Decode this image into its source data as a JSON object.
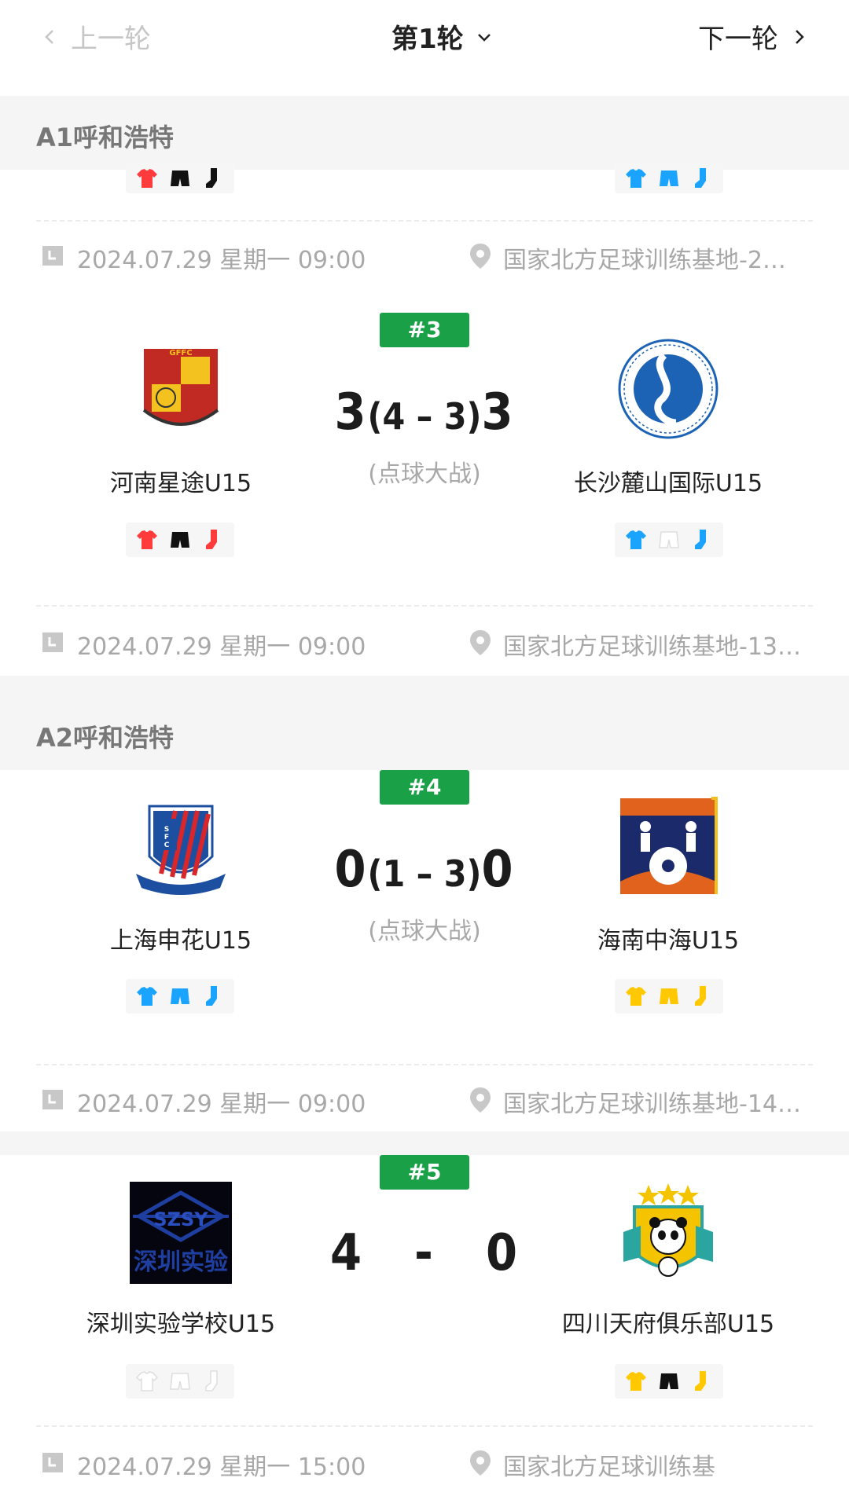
{
  "nav": {
    "prev": "上一轮",
    "round": "第1轮",
    "next": "下一轮"
  },
  "groups": [
    {
      "name": "A1呼和浩特"
    },
    {
      "name": "A2呼和浩特"
    }
  ],
  "top_partial": {
    "home_kit": [
      "#ff3b3b",
      "#111111",
      "#111111"
    ],
    "away_kit": [
      "#1aa3ff",
      "#1aa3ff",
      "#1aa3ff"
    ],
    "date": "2024.07.29 星期一 09:00",
    "location": "国家北方足球训练基地-2…"
  },
  "matches": [
    {
      "badge": "#3",
      "home": {
        "name": "河南星途U15",
        "logo": "GFFC",
        "kit": [
          "#ff3b3b",
          "#111111",
          "#ff3b3b"
        ]
      },
      "away": {
        "name": "长沙麓山国际U15",
        "logo": "LUSHAN",
        "kit": [
          "#1aa3ff",
          "#ffffff",
          "#1aa3ff"
        ]
      },
      "score_home": "3",
      "pen_home": "4",
      "pen_away": "3",
      "score_away": "3",
      "pk_label": "(点球大战)",
      "date": "2024.07.29 星期一 09:00",
      "location": "国家北方足球训练基地-13…"
    },
    {
      "badge": "#4",
      "home": {
        "name": "上海申花U15",
        "logo": "SFC",
        "kit": [
          "#1aa3ff",
          "#1aa3ff",
          "#1aa3ff"
        ]
      },
      "away": {
        "name": "海南中海U15",
        "logo": "中海足球俱乐部",
        "kit": [
          "#ffc800",
          "#ffc800",
          "#ffc800"
        ]
      },
      "score_home": "0",
      "pen_home": "1",
      "pen_away": "3",
      "score_away": "0",
      "pk_label": "(点球大战)",
      "date": "2024.07.29 星期一 09:00",
      "location": "国家北方足球训练基地-14…"
    },
    {
      "badge": "#5",
      "home": {
        "name": "深圳实验学校U15",
        "logo": "SZSY",
        "logo_sub": "深圳实验",
        "kit": [
          "#ffffff",
          "#ffffff",
          "#ffffff"
        ]
      },
      "away": {
        "name": "四川天府俱乐部U15",
        "logo": "PANDA",
        "kit": [
          "#ffc800",
          "#111111",
          "#ffc800"
        ]
      },
      "score_home": "4",
      "score_sep": "-",
      "score_away": "0",
      "date": "2024.07.29 星期一 15:00",
      "location": "国家北方足球训练基"
    }
  ]
}
